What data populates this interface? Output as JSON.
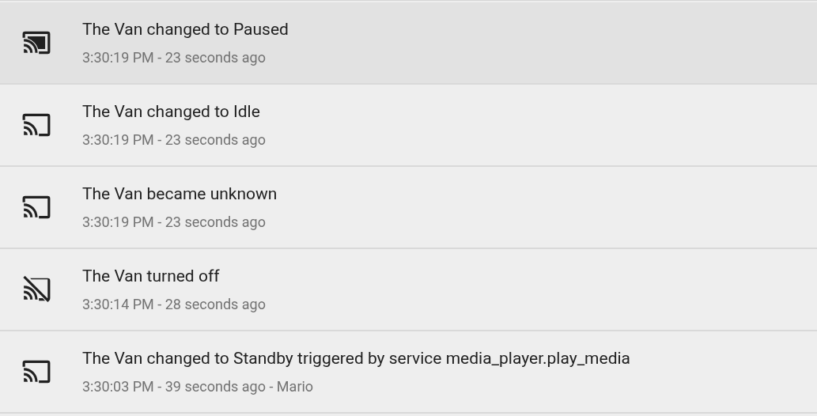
{
  "entries": [
    {
      "kind": "connected",
      "selected": true,
      "title": "The Van changed to Paused",
      "detail": "3:30:19 PM - 23 seconds ago"
    },
    {
      "kind": "available",
      "selected": false,
      "title": "The Van changed to Idle",
      "detail": "3:30:19 PM - 23 seconds ago"
    },
    {
      "kind": "available",
      "selected": false,
      "title": "The Van became unknown",
      "detail": "3:30:19 PM - 23 seconds ago"
    },
    {
      "kind": "off",
      "selected": false,
      "title": "The Van turned off",
      "detail": "3:30:14 PM - 28 seconds ago"
    },
    {
      "kind": "available",
      "selected": false,
      "title": "The Van changed to Standby triggered by service media_player.play_media",
      "detail": "3:30:03 PM - 39 seconds ago - Mario"
    }
  ]
}
